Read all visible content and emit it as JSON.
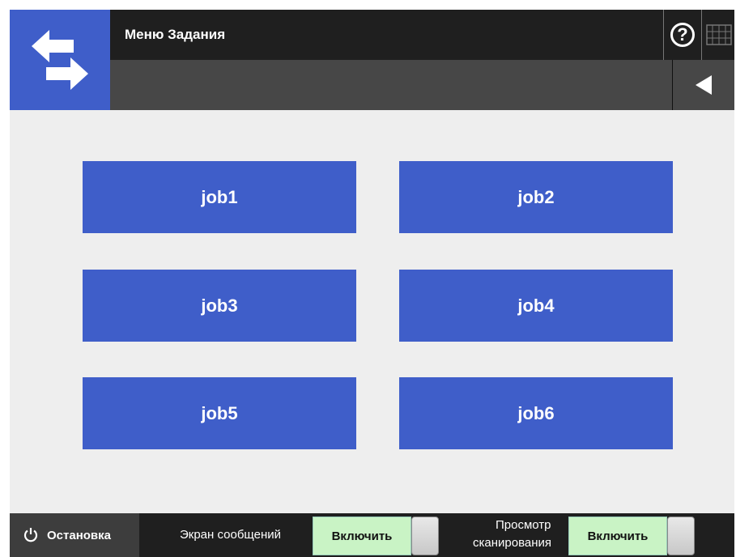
{
  "header": {
    "title": "Меню Задания",
    "help_symbol": "?",
    "logo_icon": "arrows-exchange-icon",
    "keyboard_icon": "keyboard-icon",
    "back_icon": "triangle-left-icon"
  },
  "jobs": [
    {
      "label": "job1"
    },
    {
      "label": "job2"
    },
    {
      "label": "job3"
    },
    {
      "label": "job4"
    },
    {
      "label": "job5"
    },
    {
      "label": "job6"
    }
  ],
  "footer": {
    "stop_label": "Остановка",
    "message_screen": {
      "label": "Экран сообщений",
      "value": "Включить"
    },
    "scan_preview": {
      "label_line1": "Просмотр",
      "label_line2": "сканирования",
      "value": "Включить"
    }
  },
  "colors": {
    "accent": "#3f5ec9",
    "header_dark": "#1f1f1f",
    "header_mid": "#474747",
    "background": "#eeeeee",
    "toggle_on": "#c9f3c5"
  }
}
